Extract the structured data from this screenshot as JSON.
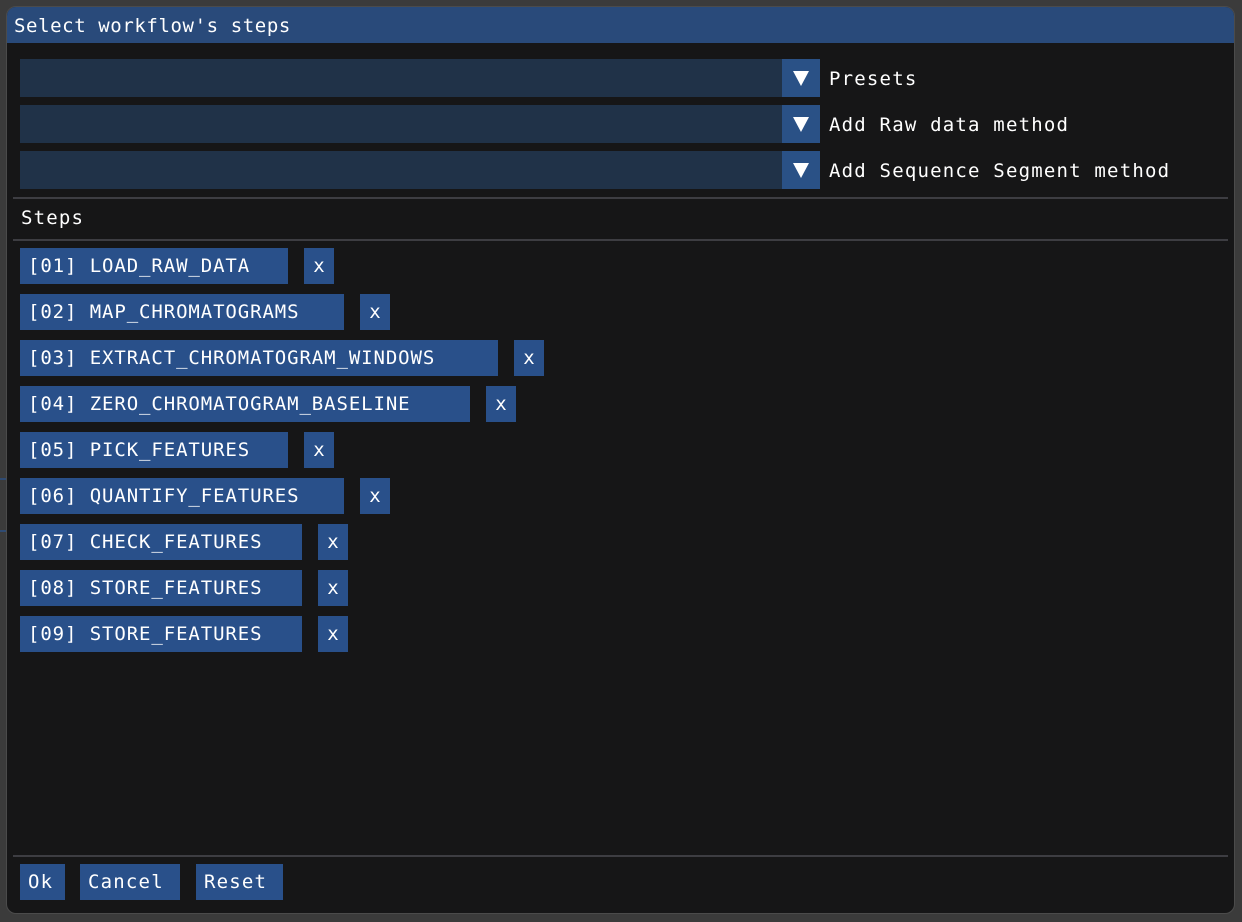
{
  "dialog": {
    "title": "Select workflow's steps"
  },
  "combos": [
    {
      "value": "",
      "label": "Presets"
    },
    {
      "value": "",
      "label": "Add Raw data method"
    },
    {
      "value": "",
      "label": "Add Sequence Segment method"
    }
  ],
  "steps_header": "Steps",
  "steps": [
    {
      "label": "[01] LOAD_RAW_DATA",
      "remove": "x"
    },
    {
      "label": "[02] MAP_CHROMATOGRAMS",
      "remove": "x"
    },
    {
      "label": "[03] EXTRACT_CHROMATOGRAM_WINDOWS",
      "remove": "x"
    },
    {
      "label": "[04] ZERO_CHROMATOGRAM_BASELINE",
      "remove": "x"
    },
    {
      "label": "[05] PICK_FEATURES",
      "remove": "x"
    },
    {
      "label": "[06] QUANTIFY_FEATURES",
      "remove": "x"
    },
    {
      "label": "[07] CHECK_FEATURES",
      "remove": "x"
    },
    {
      "label": "[08] STORE_FEATURES",
      "remove": "x"
    },
    {
      "label": "[09] STORE_FEATURES",
      "remove": "x"
    }
  ],
  "footer": {
    "ok": "Ok",
    "cancel": "Cancel",
    "reset": "Reset"
  },
  "colors": {
    "titlebar": "#294a7a",
    "button": "#29508a",
    "combo_bg": "#203248",
    "window_bg": "#161617"
  }
}
